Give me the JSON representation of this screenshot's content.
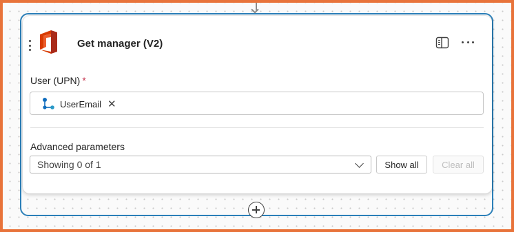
{
  "action": {
    "title": "Get manager (V2)",
    "icon": "office-365-icon",
    "header_icons": [
      "panel-icon",
      "more-options-icon"
    ]
  },
  "fields": {
    "user_upn": {
      "label": "User (UPN)",
      "required_marker": "*",
      "token": {
        "label": "UserEmail",
        "icon": "variable-icon",
        "remove_glyph": "✕"
      }
    }
  },
  "advanced": {
    "label": "Advanced parameters",
    "select_value": "Showing 0 of 1",
    "show_all_label": "Show all",
    "clear_all_label": "Clear all"
  },
  "colors": {
    "frame_border": "#e8733a",
    "selection_border": "#2b7fb8",
    "required": "#c4314b",
    "office_red": "#d83b01",
    "token_blue": "#0f6cbd"
  }
}
